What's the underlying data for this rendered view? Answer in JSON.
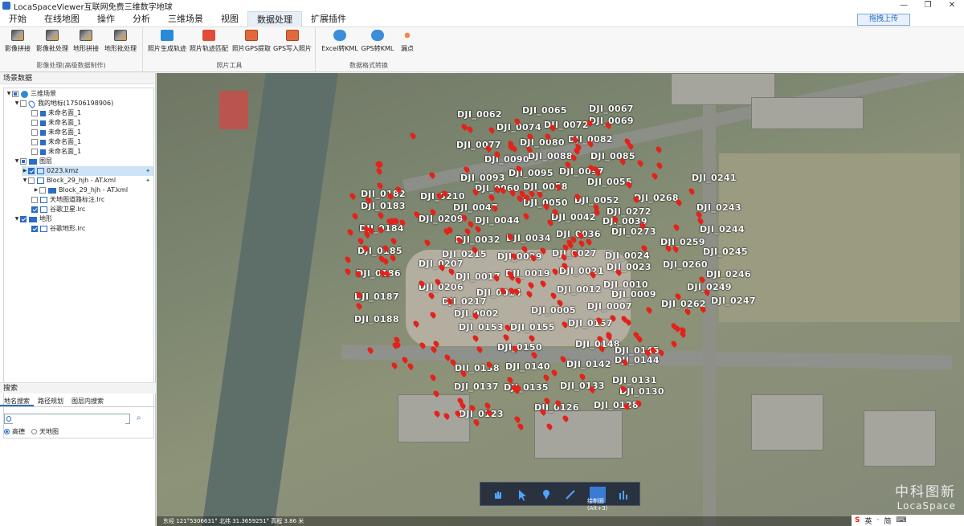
{
  "app": {
    "title": "LocaSpaceViewer互联网免费三维数字地球",
    "controls": [
      "—",
      "❐",
      "✕"
    ]
  },
  "menu": [
    "开始",
    "在线地图",
    "操作",
    "分析",
    "三维场景",
    "视图",
    "数据处理",
    "扩展插件"
  ],
  "menu_active": "数据处理",
  "upload_label": "拖拽上传",
  "ribbon": {
    "groups": [
      {
        "label": "影像处理(高级数据制作)",
        "buttons": [
          "影像拼接",
          "影像批处理",
          "地形拼接",
          "地形批处理"
        ]
      },
      {
        "label": "照片工具",
        "buttons": [
          "照片生成轨迹",
          "照片轨迹匹配",
          "照片GPS提取",
          "GPS写入照片"
        ]
      },
      {
        "label": "数据格式转换",
        "buttons": [
          "Excel转KML",
          "GPS转KML",
          "漏点"
        ]
      }
    ]
  },
  "left": {
    "header": "场景数据",
    "tree": [
      "三维场景",
      "我的地标(17506198906)",
      "未命名面_1",
      "未命名面_1",
      "未命名面_1",
      "未命名面_1",
      "未命名面_1",
      "图层",
      "0223.kmz",
      "Block_29_hjh - AT.kml",
      "Block_29_hjh - AT.kml",
      "天地图道路标注.lrc",
      "谷歌卫星.lrc",
      "地形",
      "谷歌地形.lrc"
    ],
    "search_header": "搜索",
    "search_tabs": [
      "地名搜索",
      "路径规划",
      "图层内搜索"
    ],
    "search_placeholder": "",
    "radio_options": [
      "高德",
      "天地图"
    ]
  },
  "map": {
    "labels": [
      "DJI_0062",
      "DJI_0065",
      "DJI_0067",
      "DJI_0074",
      "DJI_0072",
      "DJI_0069",
      "DJI_0077",
      "DJI_0080",
      "DJI_0082",
      "DJI_0090",
      "DJI_0088",
      "DJI_0085",
      "DJI_0093",
      "DJI_0095",
      "DJI_0097",
      "DJI_0055",
      "DJI_0241",
      "DJI_0182",
      "DJI_0060",
      "DJI_0058",
      "DJI_0210",
      "DJI_0052",
      "DJI_0268",
      "DJI_0183",
      "DJI_0047",
      "DJI_0050",
      "DJI_0272",
      "DJI_0243",
      "DJI_0209",
      "DJI_0044",
      "DJI_0042",
      "DJI_0039",
      "DJI_0184",
      "DJI_0036",
      "DJI_0273",
      "DJI_0244",
      "DJI_0032",
      "DJI_0034",
      "DJI_0259",
      "DJI_0185",
      "DJI_0215",
      "DJI_0029",
      "DJI_0027",
      "DJI_0024",
      "DJI_0245",
      "DJI_0207",
      "DJI_0023",
      "DJI_0260",
      "DJI_0021",
      "DJI_0186",
      "DJI_0017",
      "DJI_0019",
      "DJI_0246",
      "DJI_0010",
      "DJI_0206",
      "DJI_0014",
      "DJI_0012",
      "DJI_0249",
      "DJI_0009",
      "DJI_0187",
      "DJI_0217",
      "DJI_0262",
      "DJI_0247",
      "DJI_0007",
      "DJI_0005",
      "DJI_0002",
      "DJI_0188",
      "DJI_0157",
      "DJI_0153",
      "DJI_0155",
      "DJI_0150",
      "DJI_0148",
      "DJI_0145",
      "DJI_0144",
      "DJI_0142",
      "DJI_0138",
      "DJI_0140",
      "DJI_0131",
      "DJI_0137",
      "DJI_0135",
      "DJI_0133",
      "DJI_0130",
      "DJI_0128",
      "DJI_0126",
      "DJI_0123"
    ],
    "tool_label_1": "绘制面",
    "tool_label_2": "(Alt+3)",
    "status_text": "东经 121°5306631°  北纬 31.3659251°  高程 3.86 米",
    "brand_cn": "中科图新",
    "brand_en": "LocaSpace",
    "tray": [
      "S",
      "英",
      "·",
      "简",
      "⌨"
    ]
  }
}
